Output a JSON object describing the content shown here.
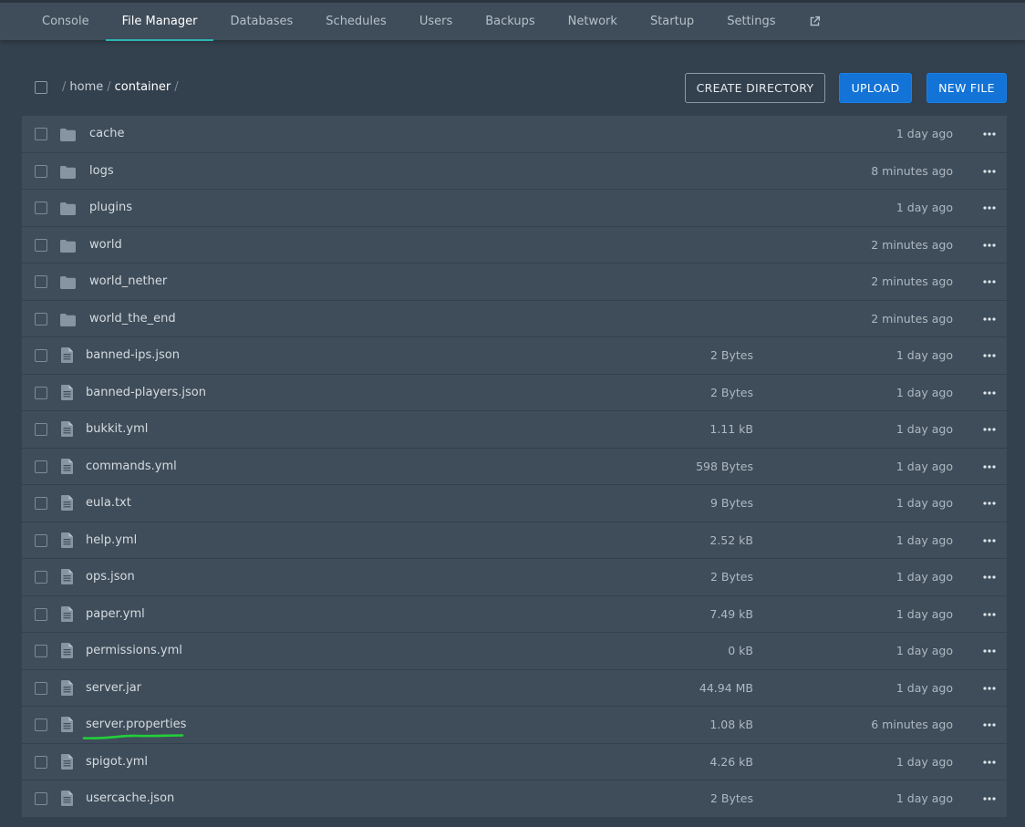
{
  "nav": {
    "tabs": [
      {
        "label": "Console"
      },
      {
        "label": "File Manager"
      },
      {
        "label": "Databases"
      },
      {
        "label": "Schedules"
      },
      {
        "label": "Users"
      },
      {
        "label": "Backups"
      },
      {
        "label": "Network"
      },
      {
        "label": "Startup"
      },
      {
        "label": "Settings"
      }
    ],
    "active_tab": "File Manager",
    "external_icon": "external-link-icon"
  },
  "breadcrumb": {
    "sep": "/",
    "home": "home",
    "current": "container"
  },
  "toolbar": {
    "create_directory_label": "CREATE DIRECTORY",
    "upload_label": "UPLOAD",
    "new_file_label": "NEW FILE"
  },
  "colors": {
    "primary_button": "#1373d6",
    "active_tab_underline": "#2bb5b0",
    "annotation_underline": "#22d03a"
  },
  "files": [
    {
      "name": "cache",
      "type": "folder",
      "size": "",
      "modified": "1 day ago"
    },
    {
      "name": "logs",
      "type": "folder",
      "size": "",
      "modified": "8 minutes ago"
    },
    {
      "name": "plugins",
      "type": "folder",
      "size": "",
      "modified": "1 day ago"
    },
    {
      "name": "world",
      "type": "folder",
      "size": "",
      "modified": "2 minutes ago"
    },
    {
      "name": "world_nether",
      "type": "folder",
      "size": "",
      "modified": "2 minutes ago"
    },
    {
      "name": "world_the_end",
      "type": "folder",
      "size": "",
      "modified": "2 minutes ago"
    },
    {
      "name": "banned-ips.json",
      "type": "file",
      "size": "2 Bytes",
      "modified": "1 day ago"
    },
    {
      "name": "banned-players.json",
      "type": "file",
      "size": "2 Bytes",
      "modified": "1 day ago"
    },
    {
      "name": "bukkit.yml",
      "type": "file",
      "size": "1.11 kB",
      "modified": "1 day ago"
    },
    {
      "name": "commands.yml",
      "type": "file",
      "size": "598 Bytes",
      "modified": "1 day ago"
    },
    {
      "name": "eula.txt",
      "type": "file",
      "size": "9 Bytes",
      "modified": "1 day ago"
    },
    {
      "name": "help.yml",
      "type": "file",
      "size": "2.52 kB",
      "modified": "1 day ago"
    },
    {
      "name": "ops.json",
      "type": "file",
      "size": "2 Bytes",
      "modified": "1 day ago"
    },
    {
      "name": "paper.yml",
      "type": "file",
      "size": "7.49 kB",
      "modified": "1 day ago"
    },
    {
      "name": "permissions.yml",
      "type": "file",
      "size": "0 kB",
      "modified": "1 day ago"
    },
    {
      "name": "server.jar",
      "type": "file",
      "size": "44.94 MB",
      "modified": "1 day ago"
    },
    {
      "name": "server.properties",
      "type": "file",
      "size": "1.08 kB",
      "modified": "6 minutes ago",
      "highlighted": true
    },
    {
      "name": "spigot.yml",
      "type": "file",
      "size": "4.26 kB",
      "modified": "1 day ago"
    },
    {
      "name": "usercache.json",
      "type": "file",
      "size": "2 Bytes",
      "modified": "1 day ago"
    }
  ]
}
